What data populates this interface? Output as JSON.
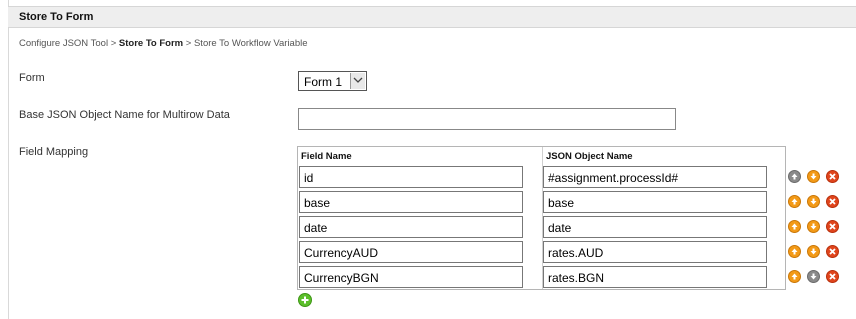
{
  "header": {
    "title": "Store To Form"
  },
  "breadcrumb": {
    "items": [
      "Configure JSON Tool",
      "Store To Form",
      "Store To Workflow Variable"
    ],
    "separator": ">"
  },
  "form_field": {
    "label": "Form",
    "value": "Form 1"
  },
  "base_json": {
    "label": "Base JSON Object Name for Multirow Data",
    "value": ""
  },
  "field_mapping": {
    "label": "Field Mapping",
    "columns": [
      "Field Name",
      "JSON Object Name"
    ],
    "rows": [
      {
        "field": "id",
        "json": "#assignment.processId#",
        "up_enabled": false,
        "down_enabled": true
      },
      {
        "field": "base",
        "json": "base",
        "up_enabled": true,
        "down_enabled": true
      },
      {
        "field": "date",
        "json": "date",
        "up_enabled": true,
        "down_enabled": true
      },
      {
        "field": "CurrencyAUD",
        "json": "rates.AUD",
        "up_enabled": true,
        "down_enabled": true
      },
      {
        "field": "CurrencyBGN",
        "json": "rates.BGN",
        "up_enabled": true,
        "down_enabled": false
      }
    ]
  },
  "icons": {
    "move_up": "arrow-up-icon",
    "move_down": "arrow-down-icon",
    "delete": "delete-icon",
    "add": "add-icon",
    "dropdown": "chevron-down-icon"
  },
  "colors": {
    "enabled_arrow": "#f39a17",
    "disabled_arrow": "#8a8a8a",
    "delete": "#e0451c",
    "add": "#5bbf2a",
    "header_bg": "#eeeeee"
  }
}
